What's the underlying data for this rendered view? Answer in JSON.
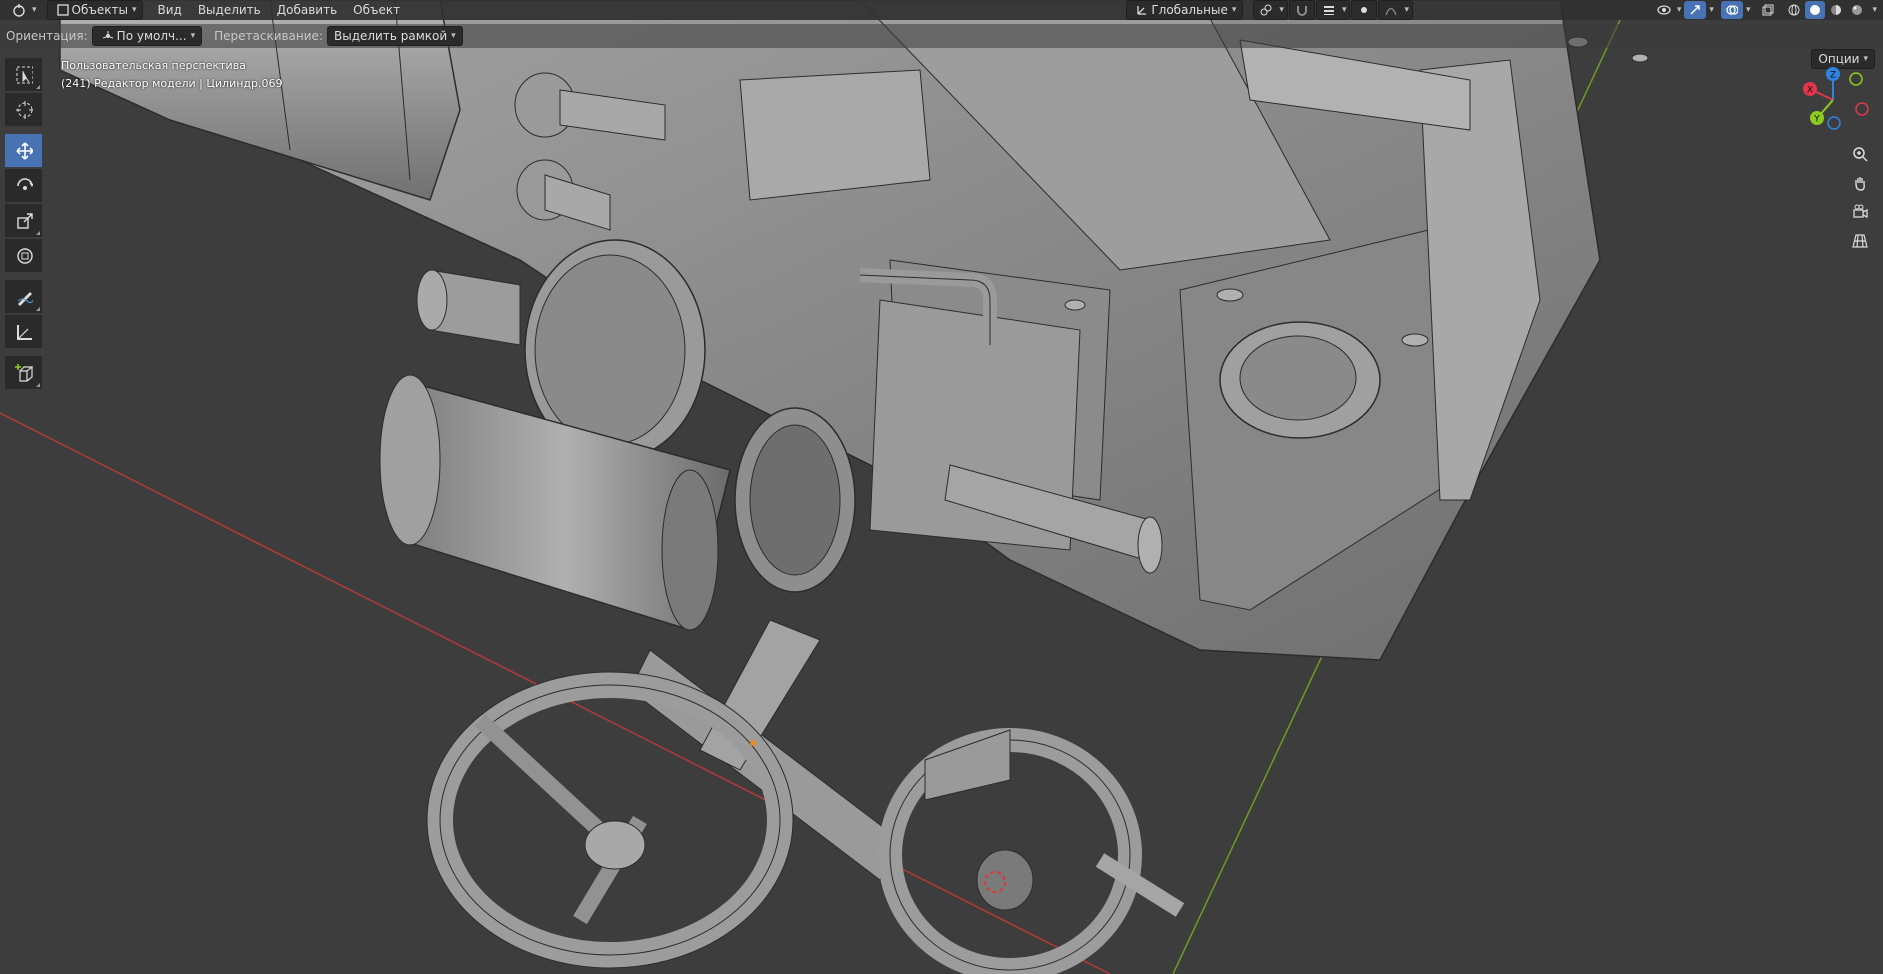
{
  "header": {
    "mode_label": "Объекты",
    "menus": [
      "Вид",
      "Выделить",
      "Добавить",
      "Объект"
    ],
    "transform_orientation": "Глобальные"
  },
  "tool_settings": {
    "orientation_label": "Ориентация:",
    "orientation_value": "По умолч...",
    "drag_label": "Перетаскивание:",
    "drag_value": "Выделить рамкой",
    "options_label": "Опции"
  },
  "viewport": {
    "view_name": "Пользовательская перспектива",
    "object_info": "(241) Редактор модели | Цилиндр.069"
  },
  "gizmo": {
    "x_label": "X",
    "y_label": "Y",
    "z_label": "Z"
  },
  "toolbar": {
    "tools": [
      "select-box",
      "cursor",
      "move",
      "rotate",
      "scale",
      "transform",
      "annotate",
      "measure",
      "add-cube"
    ],
    "active_tool": "move"
  },
  "colors": {
    "active_tool": "#4772b3",
    "axis_x": "#e0374a",
    "axis_y": "#8ccc1f",
    "axis_z": "#2f84e3",
    "background": "#3d3d3d",
    "model": "#8e8e8e"
  }
}
